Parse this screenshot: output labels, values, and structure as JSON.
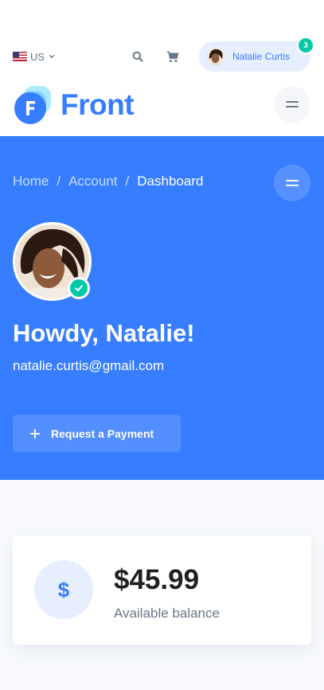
{
  "topbar": {
    "locale": "US",
    "flag_icon": "us-flag-icon",
    "search_icon": "search-icon",
    "cart_icon": "cart-icon",
    "user": {
      "name": "Natalie Curtis",
      "notification_count": "3"
    }
  },
  "brand": {
    "name": "Front",
    "color": "#377dff",
    "logo_letter": "F"
  },
  "hero": {
    "breadcrumb": [
      "Home",
      "Account",
      "Dashboard"
    ],
    "greeting": "Howdy, Natalie!",
    "email": "natalie.curtis@gmail.com",
    "request_button": "Request a Payment",
    "background": "#377dff"
  },
  "balance": {
    "icon_glyph": "$",
    "amount": "$45.99",
    "label": "Available balance"
  },
  "colors": {
    "accent": "#377dff",
    "success": "#00c9a7",
    "muted": "#677788"
  }
}
